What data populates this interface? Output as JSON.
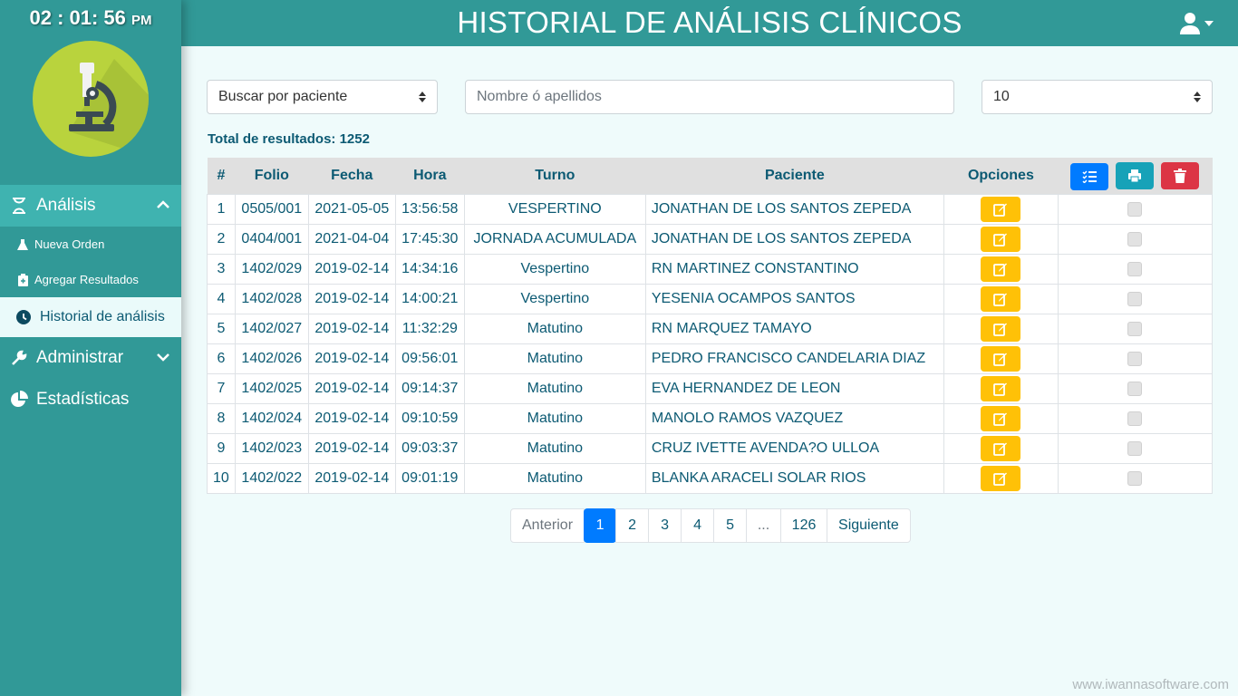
{
  "clock": {
    "time": "02 : 01: 56",
    "ampm": "PM"
  },
  "header": {
    "title": "HISTORIAL DE ANÁLISIS CLÍNICOS"
  },
  "sidebar": {
    "sections": [
      {
        "label": "Análisis",
        "icon": "hourglass-icon"
      },
      {
        "label": "Administrar",
        "icon": "wrench-icon"
      },
      {
        "label": "Estadísticas",
        "icon": "pie-chart-icon"
      }
    ],
    "subitems": [
      {
        "label": "Nueva Orden",
        "icon": "flask-icon"
      },
      {
        "label": "Agregar Resultados",
        "icon": "clipboard-icon"
      },
      {
        "label": "Historial de análisis",
        "icon": "clock-icon"
      }
    ]
  },
  "filters": {
    "search_by": "Buscar por paciente",
    "name_placeholder": "Nombre ó apellidos",
    "page_size": "10"
  },
  "summary": {
    "total_label": "Total de resultados: 1252"
  },
  "table": {
    "headers": [
      "#",
      "Folio",
      "Fecha",
      "Hora",
      "Turno",
      "Paciente",
      "Opciones"
    ],
    "rows": [
      {
        "n": "1",
        "folio": "0505/001",
        "fecha": "2021-05-05",
        "hora": "13:56:58",
        "turno": "VESPERTINO",
        "paciente": "JONATHAN DE LOS SANTOS ZEPEDA"
      },
      {
        "n": "2",
        "folio": "0404/001",
        "fecha": "2021-04-04",
        "hora": "17:45:30",
        "turno": "JORNADA ACUMULADA",
        "paciente": "JONATHAN DE LOS SANTOS ZEPEDA"
      },
      {
        "n": "3",
        "folio": "1402/029",
        "fecha": "2019-02-14",
        "hora": "14:34:16",
        "turno": "Vespertino",
        "paciente": "RN MARTINEZ CONSTANTINO"
      },
      {
        "n": "4",
        "folio": "1402/028",
        "fecha": "2019-02-14",
        "hora": "14:00:21",
        "turno": "Vespertino",
        "paciente": "YESENIA OCAMPOS SANTOS"
      },
      {
        "n": "5",
        "folio": "1402/027",
        "fecha": "2019-02-14",
        "hora": "11:32:29",
        "turno": "Matutino",
        "paciente": "RN MARQUEZ TAMAYO"
      },
      {
        "n": "6",
        "folio": "1402/026",
        "fecha": "2019-02-14",
        "hora": "09:56:01",
        "turno": "Matutino",
        "paciente": "PEDRO FRANCISCO CANDELARIA DIAZ"
      },
      {
        "n": "7",
        "folio": "1402/025",
        "fecha": "2019-02-14",
        "hora": "09:14:37",
        "turno": "Matutino",
        "paciente": "EVA HERNANDEZ DE LEON"
      },
      {
        "n": "8",
        "folio": "1402/024",
        "fecha": "2019-02-14",
        "hora": "09:10:59",
        "turno": "Matutino",
        "paciente": "MANOLO RAMOS VAZQUEZ"
      },
      {
        "n": "9",
        "folio": "1402/023",
        "fecha": "2019-02-14",
        "hora": "09:03:37",
        "turno": "Matutino",
        "paciente": "CRUZ IVETTE AVENDA?O ULLOA"
      },
      {
        "n": "10",
        "folio": "1402/022",
        "fecha": "2019-02-14",
        "hora": "09:01:19",
        "turno": "Matutino",
        "paciente": "BLANKA ARACELI SOLAR RIOS"
      }
    ]
  },
  "pagination": {
    "prev": "Anterior",
    "pages": [
      "1",
      "2",
      "3",
      "4",
      "5"
    ],
    "ellipsis": "...",
    "last_page": "126",
    "next": "Siguiente",
    "current": "1"
  },
  "watermark": "www.iwannasoftware.com",
  "colors": {
    "sidebar": "#319997",
    "header": "#319997",
    "background": "#effbfb",
    "edit_button": "#ffc107",
    "primary": "#007bff",
    "info": "#17a2b8",
    "danger": "#dc3545"
  }
}
